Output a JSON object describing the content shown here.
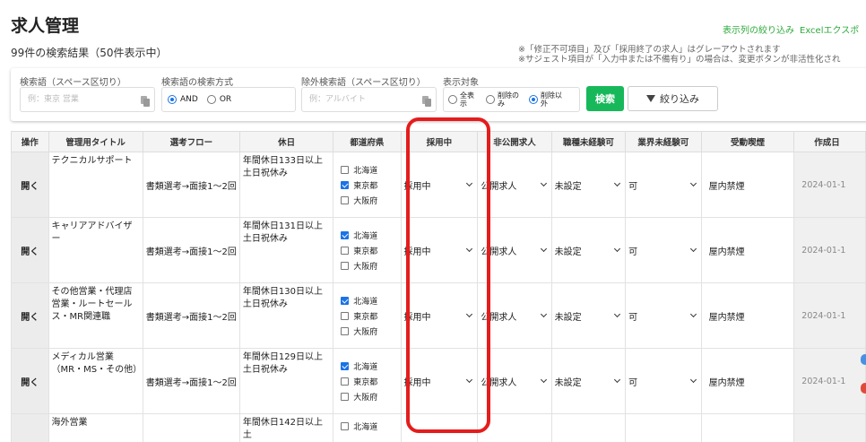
{
  "header": {
    "title": "求人管理",
    "result_count": "99件の検索結果（50件表示中）",
    "links": [
      "表示列の絞り込み",
      "Excelエクスポ"
    ],
    "notes": [
      "※「修正不可項目」及び「採用終了の求人」はグレーアウトされます",
      "※サジェスト項目が「入力中または不備有り」の場合は、変更ボタンが非活性化され"
    ]
  },
  "search": {
    "keyword_label": "検索語（スペース区切り）",
    "keyword_placeholder": "例：東京 営業",
    "method_label": "検索語の検索方式",
    "method_and": "AND",
    "method_or": "OR",
    "exclude_label": "除外検索語（スペース区切り）",
    "exclude_placeholder": "例：アルバイト",
    "target_label": "表示対象",
    "target_all": "全表示",
    "target_only_deleted": "削除のみ",
    "target_except_deleted": "削除以外",
    "search_button": "検索",
    "filter_button": "絞り込み"
  },
  "table": {
    "columns": [
      "操作",
      "管理用タイトル",
      "選考フロー",
      "休日",
      "都道府県",
      "採用中",
      "非公開求人",
      "職種未経験可",
      "業界未経験可",
      "受動喫煙",
      "作成日"
    ],
    "open_label": "開く",
    "prefectures": [
      "北海道",
      "東京都",
      "大阪府"
    ],
    "rows": [
      {
        "title": "テクニカルサポート",
        "flow": "書類選考→面接1～2回",
        "holiday": "年間休日133日以上土日祝休み",
        "pref_checked": [
          false,
          true,
          false
        ],
        "hiring": "採用中",
        "private": "公開求人",
        "job_exp": "未設定",
        "industry_exp": "可",
        "smoking": "屋内禁煙",
        "date": "2024-01-1"
      },
      {
        "title": "キャリアアドバイザー",
        "flow": "書類選考→面接1～2回",
        "holiday": "年間休日131日以上土日祝休み",
        "pref_checked": [
          true,
          false,
          false
        ],
        "hiring": "採用中",
        "private": "公開求人",
        "job_exp": "未設定",
        "industry_exp": "可",
        "smoking": "屋内禁煙",
        "date": "2024-01-1"
      },
      {
        "title": "その他営業・代理店営業・ルートセールス・MR関連職",
        "flow": "書類選考→面接1～2回",
        "holiday": "年間休日130日以上土日祝休み",
        "pref_checked": [
          true,
          false,
          false
        ],
        "hiring": "採用中",
        "private": "公開求人",
        "job_exp": "未設定",
        "industry_exp": "可",
        "smoking": "屋内禁煙",
        "date": "2024-01-1"
      },
      {
        "title": "メディカル営業（MR・MS・その他）",
        "flow": "書類選考→面接1～2回",
        "holiday": "年間休日129日以上土日祝休み",
        "pref_checked": [
          true,
          false,
          false
        ],
        "hiring": "採用中",
        "private": "公開求人",
        "job_exp": "未設定",
        "industry_exp": "可",
        "smoking": "屋内禁煙",
        "date": "2024-01-1"
      }
    ],
    "partial_row": {
      "title": "海外営業",
      "holiday": "年間休日142日以上土",
      "pref_first": "北海道"
    }
  },
  "colors": {
    "accent_green": "#17b85a",
    "highlight_red": "#e51c1c",
    "link_green": "#2eaa3c"
  }
}
